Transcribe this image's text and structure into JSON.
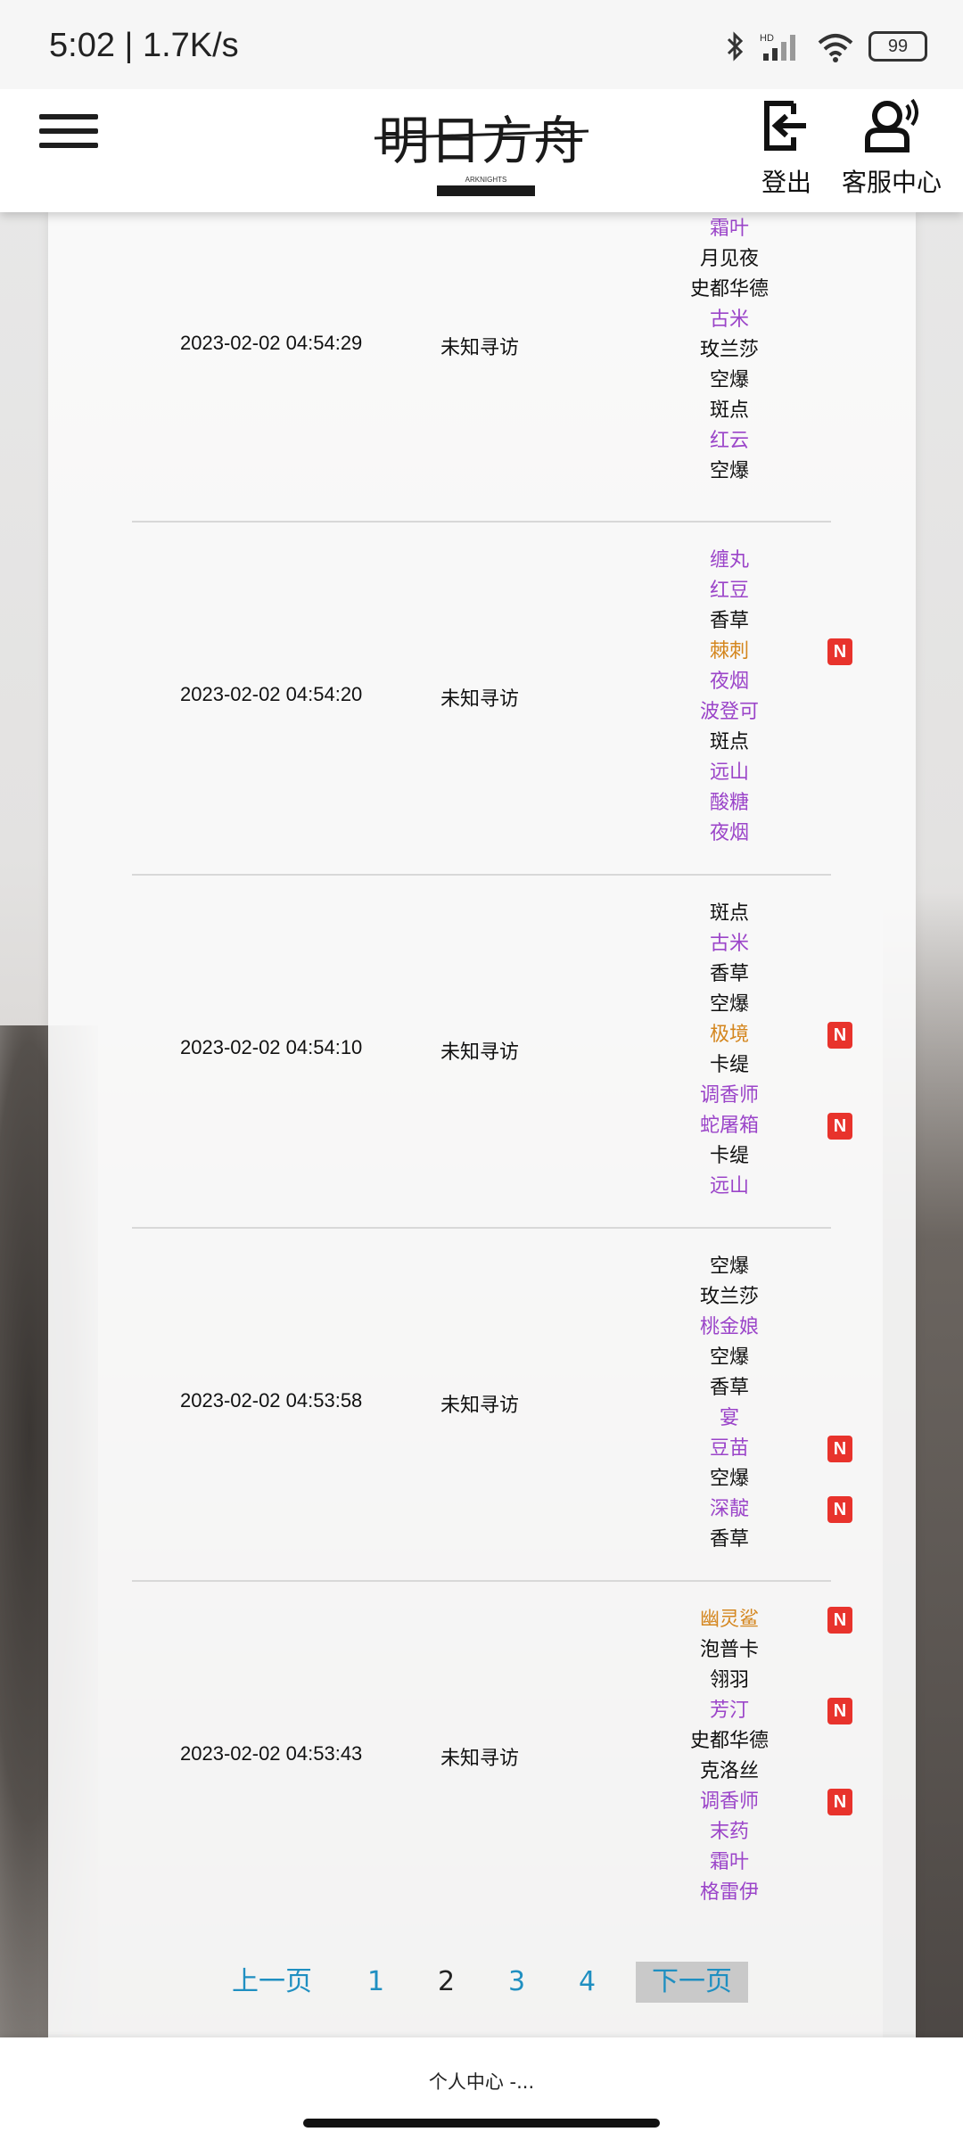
{
  "status_bar": {
    "time": "5:02 | 1.7K/s",
    "battery": "99"
  },
  "header": {
    "logo_text": "明日方舟",
    "logo_sub": "ARKNIGHTS",
    "logout_label": "登出",
    "service_label": "客服中心"
  },
  "records": [
    {
      "time": "2023-02-02 04:54:29",
      "pool": "未知寻访",
      "operators": [
        {
          "name": "霜叶",
          "rarity": "purple",
          "is_new": false
        },
        {
          "name": "月见夜",
          "rarity": "normal",
          "is_new": false
        },
        {
          "name": "史都华德",
          "rarity": "normal",
          "is_new": false
        },
        {
          "name": "古米",
          "rarity": "purple",
          "is_new": false
        },
        {
          "name": "玫兰莎",
          "rarity": "normal",
          "is_new": false
        },
        {
          "name": "空爆",
          "rarity": "normal",
          "is_new": false
        },
        {
          "name": "斑点",
          "rarity": "normal",
          "is_new": false
        },
        {
          "name": "红云",
          "rarity": "purple",
          "is_new": false
        },
        {
          "name": "空爆",
          "rarity": "normal",
          "is_new": false
        }
      ]
    },
    {
      "time": "2023-02-02 04:54:20",
      "pool": "未知寻访",
      "operators": [
        {
          "name": "缠丸",
          "rarity": "purple",
          "is_new": false
        },
        {
          "name": "红豆",
          "rarity": "purple",
          "is_new": false
        },
        {
          "name": "香草",
          "rarity": "normal",
          "is_new": false
        },
        {
          "name": "棘刺",
          "rarity": "gold",
          "is_new": true
        },
        {
          "name": "夜烟",
          "rarity": "purple",
          "is_new": false
        },
        {
          "name": "波登可",
          "rarity": "purple",
          "is_new": false
        },
        {
          "name": "斑点",
          "rarity": "normal",
          "is_new": false
        },
        {
          "name": "远山",
          "rarity": "purple",
          "is_new": false
        },
        {
          "name": "酸糖",
          "rarity": "purple",
          "is_new": false
        },
        {
          "name": "夜烟",
          "rarity": "purple",
          "is_new": false
        }
      ]
    },
    {
      "time": "2023-02-02 04:54:10",
      "pool": "未知寻访",
      "operators": [
        {
          "name": "斑点",
          "rarity": "normal",
          "is_new": false
        },
        {
          "name": "古米",
          "rarity": "purple",
          "is_new": false
        },
        {
          "name": "香草",
          "rarity": "normal",
          "is_new": false
        },
        {
          "name": "空爆",
          "rarity": "normal",
          "is_new": false
        },
        {
          "name": "极境",
          "rarity": "gold",
          "is_new": true
        },
        {
          "name": "卡缇",
          "rarity": "normal",
          "is_new": false
        },
        {
          "name": "调香师",
          "rarity": "purple",
          "is_new": false
        },
        {
          "name": "蛇屠箱",
          "rarity": "purple",
          "is_new": true
        },
        {
          "name": "卡缇",
          "rarity": "normal",
          "is_new": false
        },
        {
          "name": "远山",
          "rarity": "purple",
          "is_new": false
        }
      ]
    },
    {
      "time": "2023-02-02 04:53:58",
      "pool": "未知寻访",
      "operators": [
        {
          "name": "空爆",
          "rarity": "normal",
          "is_new": false
        },
        {
          "name": "玫兰莎",
          "rarity": "normal",
          "is_new": false
        },
        {
          "name": "桃金娘",
          "rarity": "purple",
          "is_new": false
        },
        {
          "name": "空爆",
          "rarity": "normal",
          "is_new": false
        },
        {
          "name": "香草",
          "rarity": "normal",
          "is_new": false
        },
        {
          "name": "宴",
          "rarity": "purple",
          "is_new": false
        },
        {
          "name": "豆苗",
          "rarity": "purple",
          "is_new": true
        },
        {
          "name": "空爆",
          "rarity": "normal",
          "is_new": false
        },
        {
          "name": "深靛",
          "rarity": "purple",
          "is_new": true
        },
        {
          "name": "香草",
          "rarity": "normal",
          "is_new": false
        }
      ]
    },
    {
      "time": "2023-02-02 04:53:43",
      "pool": "未知寻访",
      "operators": [
        {
          "name": "幽灵鲨",
          "rarity": "gold",
          "is_new": true
        },
        {
          "name": "泡普卡",
          "rarity": "normal",
          "is_new": false
        },
        {
          "name": "翎羽",
          "rarity": "normal",
          "is_new": false
        },
        {
          "name": "芳汀",
          "rarity": "purple",
          "is_new": true
        },
        {
          "name": "史都华德",
          "rarity": "normal",
          "is_new": false
        },
        {
          "name": "克洛丝",
          "rarity": "normal",
          "is_new": false
        },
        {
          "name": "调香师",
          "rarity": "purple",
          "is_new": true
        },
        {
          "name": "末药",
          "rarity": "purple",
          "is_new": false
        },
        {
          "name": "霜叶",
          "rarity": "purple",
          "is_new": false
        },
        {
          "name": "格雷伊",
          "rarity": "purple",
          "is_new": false
        }
      ]
    }
  ],
  "new_badge": "N",
  "pagination": {
    "prev": "上一页",
    "pages": [
      "1",
      "2",
      "3",
      "4"
    ],
    "current": "2",
    "next": "下一页"
  },
  "bottom_tab": {
    "title": "个人中心 -..."
  },
  "colors": {
    "purple": "#9b45c9",
    "gold": "#d4861e",
    "badge": "#e8332c",
    "link": "#1f8fc1"
  }
}
